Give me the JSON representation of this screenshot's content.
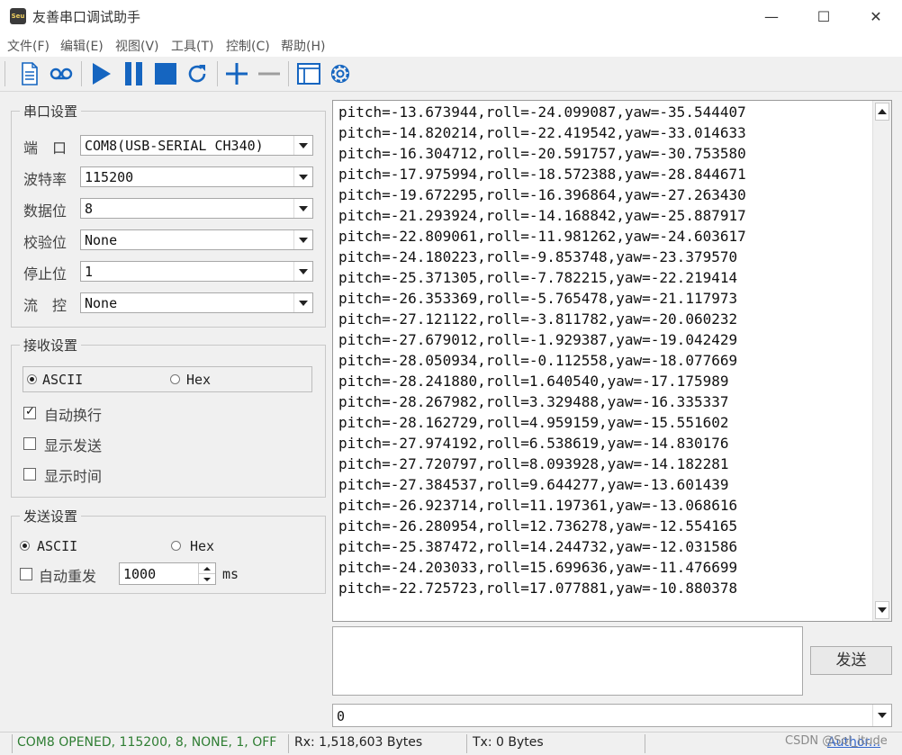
{
  "app": {
    "icon_text": "Seu",
    "title": "友善串口调试助手",
    "window_controls": {
      "minimize": "—",
      "maximize": "☐",
      "close": "✕"
    }
  },
  "menu": [
    {
      "label": "文件(F)"
    },
    {
      "label": "编辑(E)"
    },
    {
      "label": "视图(V)"
    },
    {
      "label": "工具(T)"
    },
    {
      "label": "控制(C)"
    },
    {
      "label": "帮助(H)"
    }
  ],
  "toolbar": {
    "icons": [
      "document-icon",
      "cassette-icon",
      "play-icon",
      "pause-icon",
      "stop-icon",
      "refresh-icon",
      "plus-icon",
      "minus-icon",
      "window-icon",
      "gear-icon"
    ],
    "accent_color": "#1565c0"
  },
  "serial": {
    "title": "串口设置",
    "rows": [
      {
        "label": "端　口",
        "value": "COM8(USB-SERIAL CH340)"
      },
      {
        "label": "波特率",
        "value": "115200"
      },
      {
        "label": "数据位",
        "value": "8"
      },
      {
        "label": "校验位",
        "value": "None"
      },
      {
        "label": "停止位",
        "value": "1"
      },
      {
        "label": "流　控",
        "value": "None"
      }
    ]
  },
  "receive": {
    "title": "接收设置",
    "mode_ascii": "ASCII",
    "mode_hex": "Hex",
    "selected_mode": "ASCII",
    "options": [
      {
        "label": "自动换行",
        "checked": true
      },
      {
        "label": "显示发送",
        "checked": false
      },
      {
        "label": "显示时间",
        "checked": false
      }
    ]
  },
  "send": {
    "title": "发送设置",
    "mode_ascii": "ASCII",
    "mode_hex": "Hex",
    "selected_mode": "ASCII",
    "auto_resend_label": "自动重发",
    "auto_resend_checked": false,
    "interval_value": "1000",
    "interval_unit": "ms",
    "send_button": "发送",
    "history_value": "0"
  },
  "output_lines": [
    "pitch=-13.673944,roll=-24.099087,yaw=-35.544407",
    "pitch=-14.820214,roll=-22.419542,yaw=-33.014633",
    "pitch=-16.304712,roll=-20.591757,yaw=-30.753580",
    "pitch=-17.975994,roll=-18.572388,yaw=-28.844671",
    "pitch=-19.672295,roll=-16.396864,yaw=-27.263430",
    "pitch=-21.293924,roll=-14.168842,yaw=-25.887917",
    "pitch=-22.809061,roll=-11.981262,yaw=-24.603617",
    "pitch=-24.180223,roll=-9.853748,yaw=-23.379570",
    "pitch=-25.371305,roll=-7.782215,yaw=-22.219414",
    "pitch=-26.353369,roll=-5.765478,yaw=-21.117973",
    "pitch=-27.121122,roll=-3.811782,yaw=-20.060232",
    "pitch=-27.679012,roll=-1.929387,yaw=-19.042429",
    "pitch=-28.050934,roll=-0.112558,yaw=-18.077669",
    "pitch=-28.241880,roll=1.640540,yaw=-17.175989",
    "pitch=-28.267982,roll=3.329488,yaw=-16.335337",
    "pitch=-28.162729,roll=4.959159,yaw=-15.551602",
    "pitch=-27.974192,roll=6.538619,yaw=-14.830176",
    "pitch=-27.720797,roll=8.093928,yaw=-14.182281",
    "pitch=-27.384537,roll=9.644277,yaw=-13.601439",
    "pitch=-26.923714,roll=11.197361,yaw=-13.068616",
    "pitch=-26.280954,roll=12.736278,yaw=-12.554165",
    "pitch=-25.387472,roll=14.244732,yaw=-12.031586",
    "pitch=-24.203033,roll=15.699636,yaw=-11.476699",
    "pitch=-22.725723,roll=17.077881,yaw=-10.880378"
  ],
  "status": {
    "port": "COM8 OPENED, 115200, 8, NONE, 1, OFF",
    "port_color": "#2e7d32",
    "rx": "Rx: 1,518,603 Bytes",
    "tx": "Tx: 0 Bytes",
    "watermark": "CSDN @Sol_itude",
    "author_link": "Author..."
  }
}
